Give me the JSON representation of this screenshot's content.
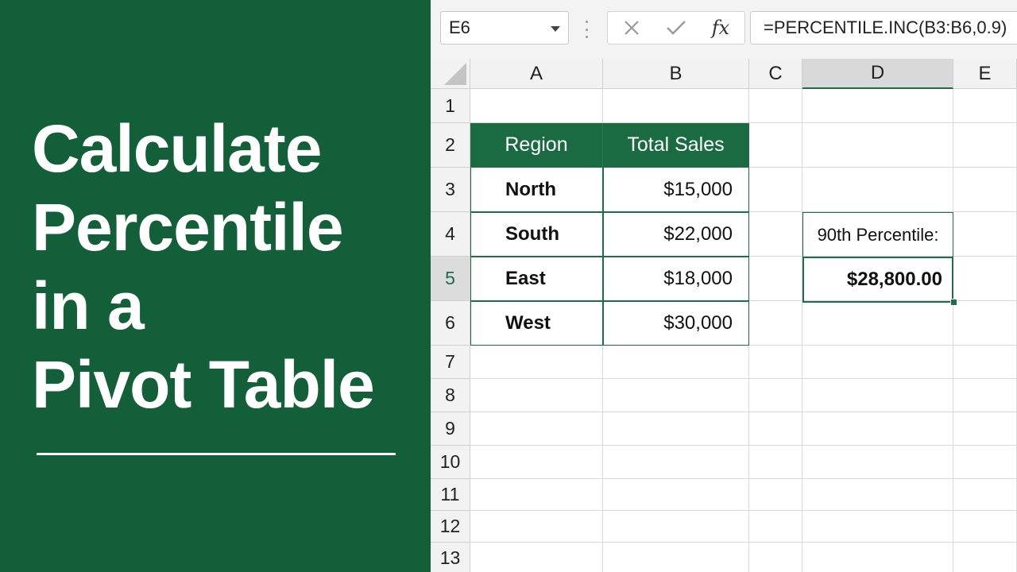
{
  "title": {
    "lines": [
      "Calculate",
      "Percentile",
      "in a",
      "Pivot Table"
    ]
  },
  "formula_bar": {
    "name_box": "E6",
    "formula": "=PERCENTILE.INC(B3:B6,0.9)",
    "cancel_icon": "close-icon",
    "enter_icon": "check-icon",
    "function_label": "fx"
  },
  "columns": [
    "A",
    "B",
    "C",
    "D",
    "E"
  ],
  "rows": [
    "1",
    "2",
    "3",
    "4",
    "5",
    "6",
    "7",
    "8",
    "9",
    "10",
    "11",
    "12",
    "13"
  ],
  "selected_column": "D",
  "selected_row": "5",
  "table": {
    "headers": [
      "Region",
      "Total Sales"
    ],
    "rows": [
      {
        "region": "North",
        "sales": "$15,000"
      },
      {
        "region": "South",
        "sales": "$22,000"
      },
      {
        "region": "East",
        "sales": "$18,000"
      },
      {
        "region": "West",
        "sales": "$30,000"
      }
    ]
  },
  "result": {
    "label": "90th Percentile:",
    "value": "$28,800.00"
  },
  "colors": {
    "brand_green": "#135f3a",
    "header_green": "#1a6b42",
    "border_green": "#1e6e45"
  }
}
